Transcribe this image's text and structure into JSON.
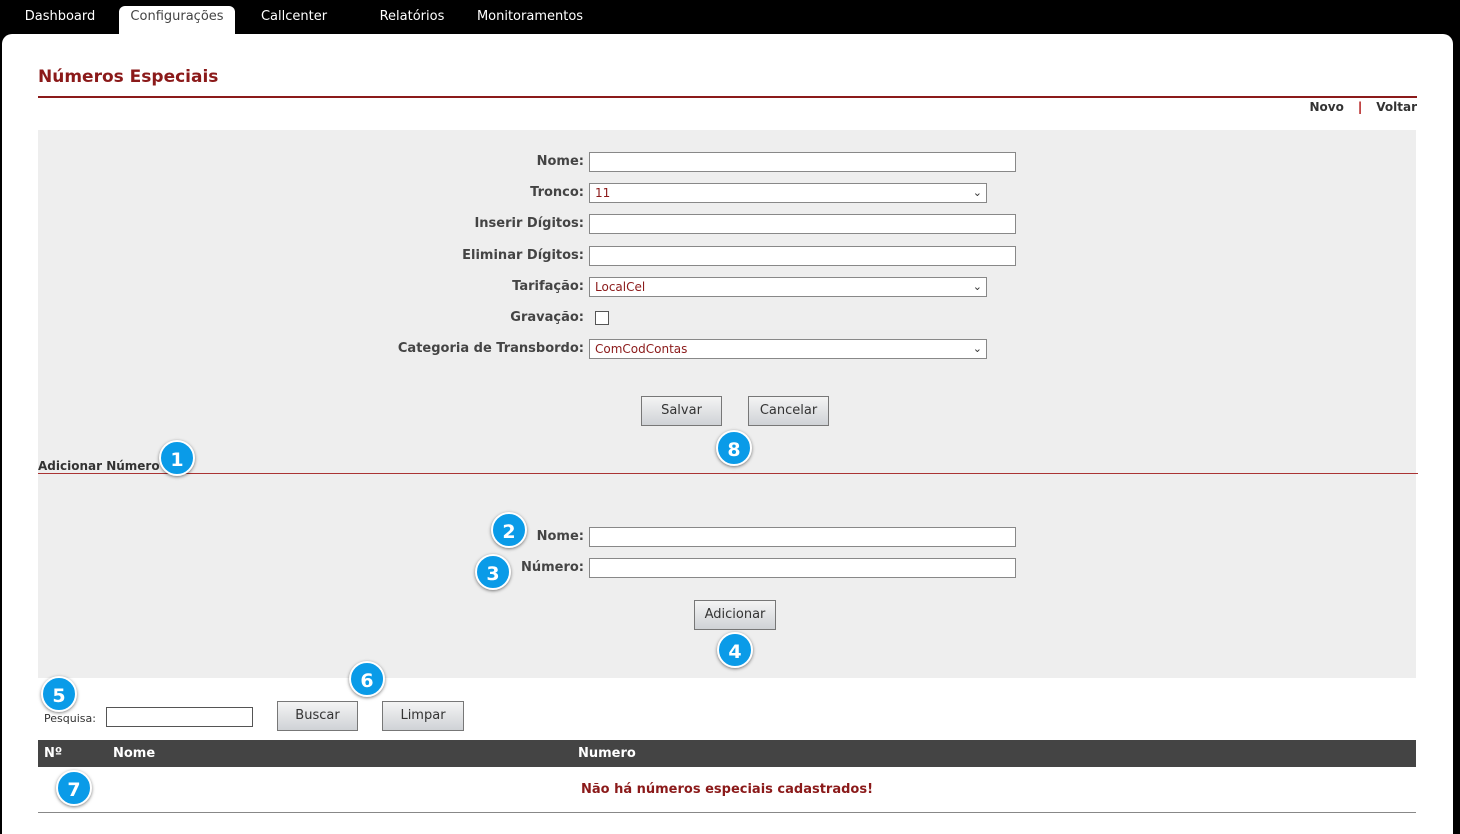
{
  "nav": {
    "tabs": [
      {
        "label": "Dashboard"
      },
      {
        "label": "Configurações",
        "active": true
      },
      {
        "label": "Callcenter"
      },
      {
        "label": "Relatórios"
      },
      {
        "label": "Monitoramentos"
      }
    ]
  },
  "page": {
    "title": "Números Especiais",
    "actions": {
      "novo": "Novo",
      "separator": "|",
      "voltar": "Voltar"
    }
  },
  "form": {
    "nome_label": "Nome:",
    "nome_value": "",
    "tronco_label": "Tronco:",
    "tronco_value": "11",
    "inserir_label": "Inserir Dígitos:",
    "inserir_value": "",
    "eliminar_label": "Eliminar Dígitos:",
    "eliminar_value": "",
    "tarifacao_label": "Tarifação:",
    "tarifacao_value": "LocalCel",
    "gravacao_label": "Gravação:",
    "gravacao_checked": false,
    "categoria_label": "Categoria de Transbordo:",
    "categoria_value": "ComCodContas",
    "save_label": "Salvar",
    "cancel_label": "Cancelar"
  },
  "add_number": {
    "section_title": "Adicionar Número",
    "nome_label": "Nome:",
    "nome_value": "",
    "numero_label": "Número:",
    "numero_value": "",
    "add_label": "Adicionar"
  },
  "search": {
    "label": "Pesquisa:",
    "value": "",
    "search_label": "Buscar",
    "clear_label": "Limpar"
  },
  "table": {
    "columns": [
      "Nº",
      "Nome",
      "Numero"
    ],
    "empty_message": "Não há números especiais cadastrados!"
  },
  "badges": [
    "1",
    "2",
    "3",
    "4",
    "5",
    "6",
    "7",
    "8"
  ],
  "colors": {
    "accent": "#8b1a1a",
    "badge": "#0a9be8",
    "header": "#444444",
    "panel": "#eeeeee"
  }
}
